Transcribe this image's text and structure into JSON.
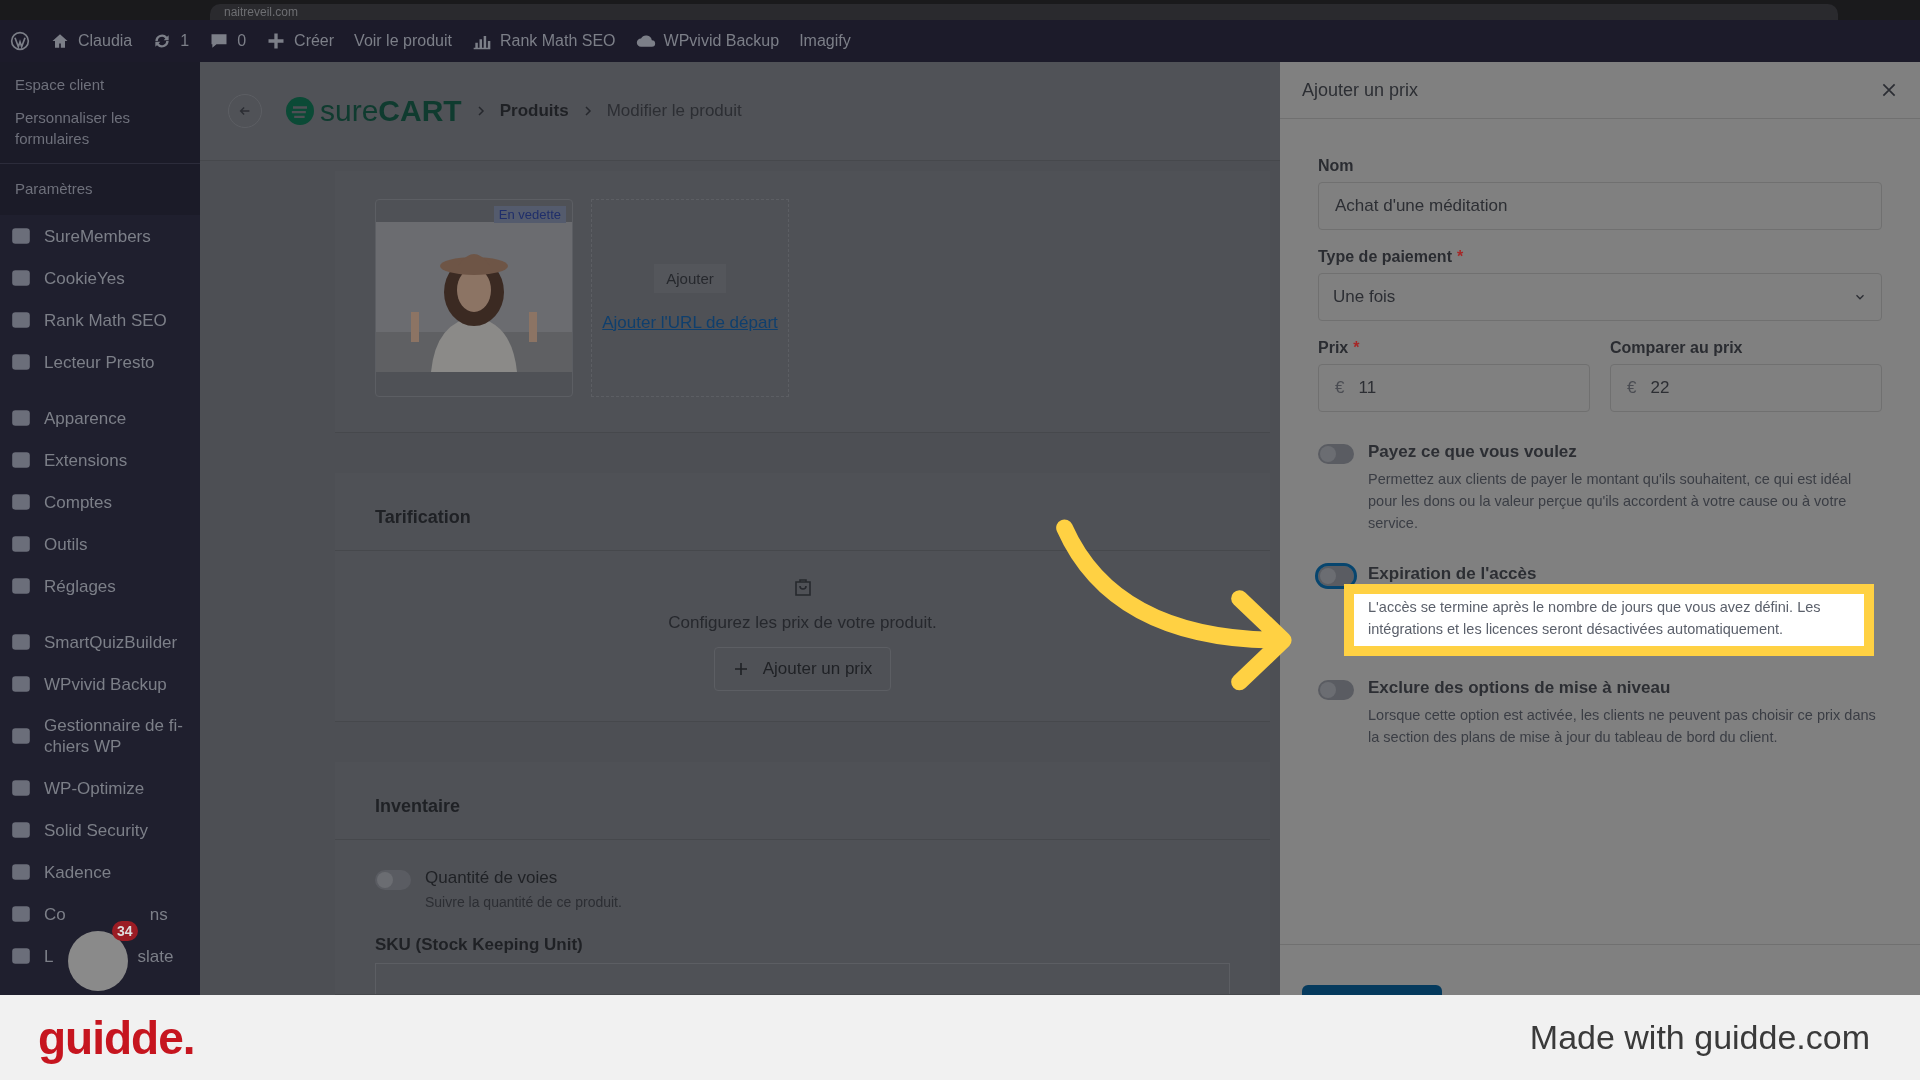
{
  "browser": {
    "url": "naitreveil.com"
  },
  "admin_bar": {
    "items": [
      {
        "kind": "wp"
      },
      {
        "kind": "home",
        "label": "Claudia"
      },
      {
        "kind": "sync",
        "label": "1"
      },
      {
        "kind": "comment",
        "label": "0"
      },
      {
        "kind": "plus",
        "label": "Créer"
      },
      {
        "kind": "text",
        "label": "Voir le produit"
      },
      {
        "kind": "chart",
        "label": "Rank Math SEO"
      },
      {
        "kind": "cloud",
        "label": "WPvivid Backup"
      },
      {
        "kind": "text",
        "label": "Imagify"
      }
    ]
  },
  "sidebar": {
    "submenu": [
      "Espace client",
      "Personnaliser les formulaires",
      "Paramètres"
    ],
    "groups": [
      [
        {
          "label": "SureMembers"
        },
        {
          "label": "CookieYes"
        },
        {
          "label": "Rank Math SEO"
        },
        {
          "label": "Lecteur Presto"
        }
      ],
      [
        {
          "label": "Apparence"
        },
        {
          "label": "Extensions"
        },
        {
          "label": "Comptes"
        },
        {
          "label": "Outils"
        },
        {
          "label": "Réglages"
        }
      ],
      [
        {
          "label": "SmartQuizBuilder"
        },
        {
          "label": "WPvivid Backup"
        },
        {
          "label": "Gestionnaire de fi-chiers WP"
        },
        {
          "label": "WP-Optimize"
        },
        {
          "label": "Solid Security"
        },
        {
          "label": "Kadence"
        },
        {
          "parts": [
            "Co",
            "ns"
          ]
        },
        {
          "parts": [
            "L",
            "slate"
          ]
        }
      ]
    ],
    "avatar": {
      "badge": "34"
    }
  },
  "header": {
    "logo_light": "sure",
    "logo_bold": "CART",
    "breadcrumb": [
      "Produits",
      "Modifier le produit"
    ]
  },
  "media": {
    "badge": "En vedette",
    "add_button": "Ajouter",
    "url_link": "Ajouter l'URL de départ"
  },
  "pricing": {
    "title": "Tarification",
    "empty_text": "Configurez les prix de votre produit.",
    "add_button": "Ajouter un prix"
  },
  "inventory": {
    "title": "Inventaire",
    "toggle": {
      "label": "Quantité de voies",
      "help": "Suivre la quantité de ce produit.",
      "on": false
    },
    "sku_label": "SKU (Stock Keeping Unit)"
  },
  "drawer": {
    "title": "Ajouter un prix",
    "name": {
      "label": "Nom",
      "value": "Achat d'une méditation"
    },
    "payment_type": {
      "label": "Type de paiement",
      "required_mark": "*",
      "value": "Une fois"
    },
    "price": {
      "label": "Prix",
      "required_mark": "*",
      "currency": "€",
      "value": "11"
    },
    "compare": {
      "label": "Comparer au prix",
      "currency": "€",
      "value": "22"
    },
    "toggles": [
      {
        "label": "Payez ce que vous voulez",
        "help": "Permettez aux clients de payer le montant qu'ils souhaitent, ce qui est idéal pour les dons ou la valeur perçue qu'ils accordent à votre cause ou à votre service.",
        "on": false,
        "highlighted": false
      },
      {
        "label": "Expiration de l'accès",
        "help": "L'accès se termine après le nombre de jours que vous avez défini. Les intégrations et les licences seront désactivées automatiquement.",
        "on": false,
        "highlighted": true
      },
      {
        "label": "Exclure des options de mise à niveau",
        "help": "Lorsque cette option est activée, les clients ne peuvent pas choisir ce prix dans la section des plans de mise à jour du tableau de bord du client.",
        "on": false,
        "highlighted": false
      }
    ]
  },
  "footer": {
    "brand": "guidde.",
    "tagline": "Made with guidde.com"
  }
}
